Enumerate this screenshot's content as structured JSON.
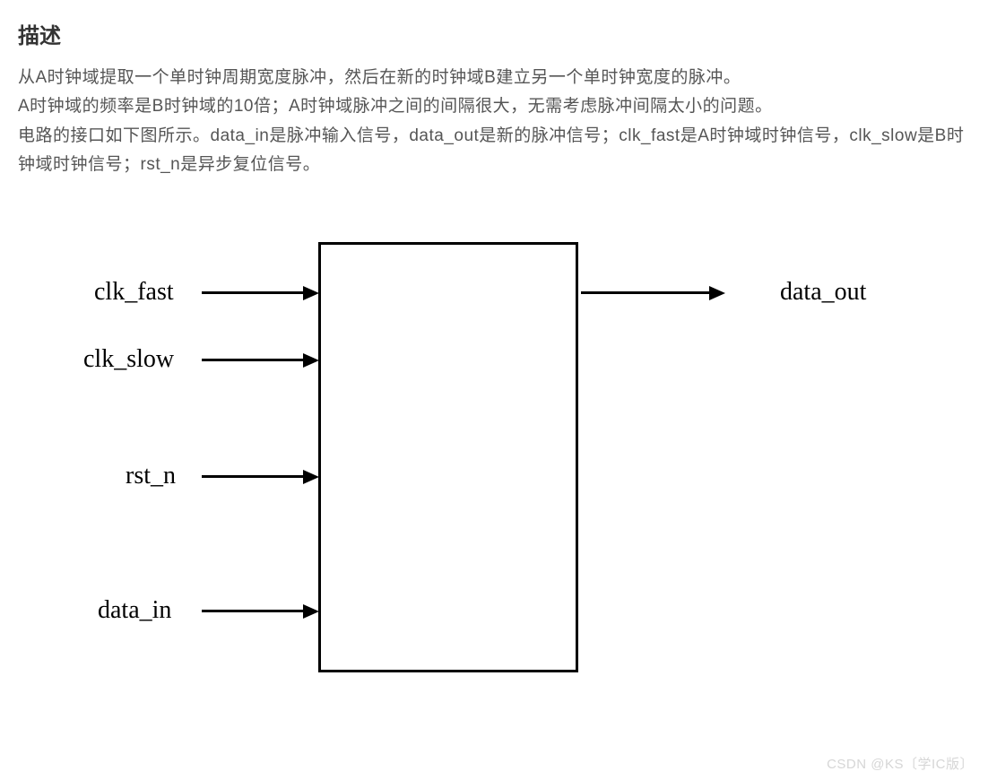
{
  "heading": "描述",
  "description": {
    "line1": "从A时钟域提取一个单时钟周期宽度脉冲，然后在新的时钟域B建立另一个单时钟宽度的脉冲。",
    "line2": "A时钟域的频率是B时钟域的10倍；A时钟域脉冲之间的间隔很大，无需考虑脉冲间隔太小的问题。",
    "line3": "电路的接口如下图所示。data_in是脉冲输入信号，data_out是新的脉冲信号；clk_fast是A时钟域时钟信号，clk_slow是B时钟域时钟信号；rst_n是异步复位信号。"
  },
  "diagram": {
    "inputs": {
      "clk_fast": "clk_fast",
      "clk_slow": "clk_slow",
      "rst_n": "rst_n",
      "data_in": "data_in"
    },
    "outputs": {
      "data_out": "data_out"
    }
  },
  "watermark": "CSDN @KS〔学IC版〕"
}
